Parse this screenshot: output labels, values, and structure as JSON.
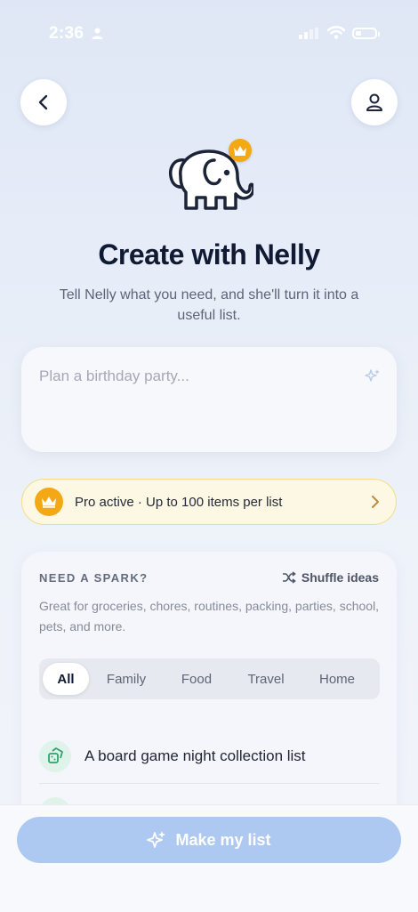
{
  "status_bar": {
    "time": "2:36"
  },
  "header": {
    "title": "Create with Nelly",
    "subtitle": "Tell Nelly what you need, and she'll turn it into a useful list."
  },
  "prompt_input": {
    "placeholder": "Plan a birthday party..."
  },
  "pro_banner": {
    "text": "Pro active · Up to 100 items per list"
  },
  "spark": {
    "heading": "NEED A SPARK?",
    "shuffle_label": "Shuffle ideas",
    "description": "Great for groceries, chores, routines, packing, parties, school, pets, and more.",
    "chips": [
      "All",
      "Family",
      "Food",
      "Travel",
      "Home"
    ],
    "active_chip": "All",
    "ideas": [
      "A board game night collection list"
    ]
  },
  "cta": {
    "label": "Make my list"
  },
  "colors": {
    "accent": "#adc9f1",
    "gold": "#f5a816",
    "title": "#111a33"
  },
  "icons": [
    "person-icon",
    "back-chevron-icon",
    "profile-icon",
    "elephant-mascot",
    "crown-icon",
    "sparkle-icon",
    "chevron-right-icon",
    "shuffle-icon",
    "dice-icon"
  ]
}
